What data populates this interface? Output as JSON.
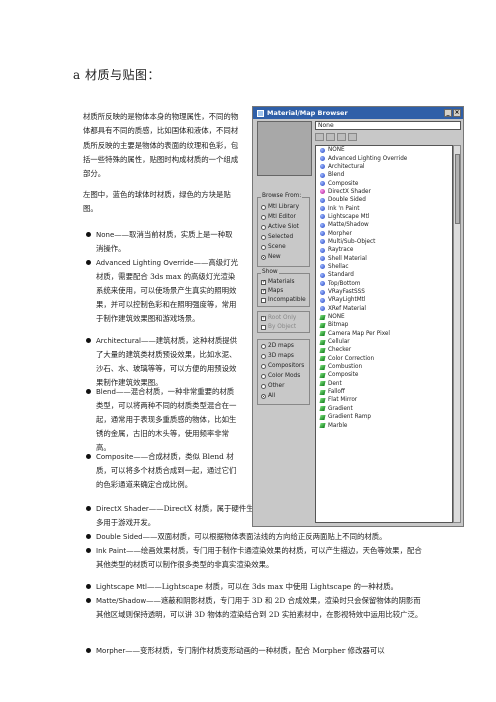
{
  "heading": "a 材质与贴图：",
  "intro": [
    "材质所反映的是物体本身的物理属性，不同的物体都具有不同的质感，比如国体和液体，不同材质所反映的主要是物体的表面的纹理和色彩，包括一些特殊的属性，贴图时构成材质的一个组成部分。",
    "左图中，蓝色的球体时材质，绿色的方块是贴图。"
  ],
  "definitions": [
    {
      "term": "None",
      "text": "——取消当前材质，实质上是一种取消操作。"
    },
    {
      "term": "Advanced Lighting Override",
      "text": "——高级灯光材质，需要配合 3ds max 的高级灯光渲染系统来使用，可以使场景产生真实的照明效果，并可以控制色彩和在照明强度等，常用于制作建筑效果图和游戏场景。"
    },
    {
      "term": "Architectural",
      "text": "——建筑材质，这种材质提供了大量的建筑类材质预设效果，比如水泥、沙石、水、玻璃等等，可以方便的用预设效果制作建筑效果图。"
    },
    {
      "term": "Blend",
      "text": "——混合材质，一种非常重要的材质类型，可以将两种不同的材质类型混合在一起，通常用于表现多重质感的物体，比如生锈的金属，古旧的木头等，使用频率非常高。"
    },
    {
      "term": "Composite",
      "text": "——合成材质，类似 Blend 材质，可以将多个材质合成到一起，通过它们的色彩通道来确定合成比例。"
    },
    {
      "term": "DirectX Shader",
      "text": "——DirectX 材质，属于硬件生成的效果，直接由显示卡运算产生的实时材质效果，多用于游戏开发。"
    },
    {
      "term": "Double Sided",
      "text": "——双面材质，可以根据物体表面法线的方向给正反两面贴上不同的材质。"
    },
    {
      "term": "Ink Paint",
      "text": "——绘画效果材质，专门用于制作卡通渲染效果的材质，可以产生描边，天色等效果，配合其他类型的材质可以制作很多类型的非真实渲染效果。"
    },
    {
      "term": "Lightscape Mtl",
      "text": "——Lightscape 材质，可以在 3ds max 中使用 Lightscape 的一种材质。"
    },
    {
      "term": "Matte/Shadow",
      "text": "——遮蔽和阴影材质，专门用于 3D 和 2D 合成效果，渲染时只会保留物体的阴影而其他区域则保持透明，可以讲 3D 物体的渲染结合到 2D 实拍素材中，在影视特效中运用比较广泛。"
    },
    {
      "term": "Morpher",
      "text": "——变形材质，专门制作材质变形动画的一种材质，配合 Morpher 修改器可以"
    }
  ],
  "browser": {
    "title": "Material/Map Browser",
    "name_value": "None",
    "browse_from_label": "Browse From:",
    "browse_from": [
      {
        "label": "Mtl Library",
        "selected": false
      },
      {
        "label": "Mtl Editor",
        "selected": false
      },
      {
        "label": "Active Slot",
        "selected": false
      },
      {
        "label": "Selected",
        "selected": false
      },
      {
        "label": "Scene",
        "selected": false
      },
      {
        "label": "New",
        "selected": true
      }
    ],
    "show_label": "Show",
    "show": [
      {
        "label": "Materials",
        "checked": true,
        "enabled": true
      },
      {
        "label": "Maps",
        "checked": true,
        "enabled": true
      },
      {
        "label": "Incompatible",
        "checked": false,
        "enabled": true
      },
      {
        "label": "Root Only",
        "checked": true,
        "enabled": false
      },
      {
        "label": "By Object",
        "checked": false,
        "enabled": false
      }
    ],
    "map_types": [
      {
        "label": "2D maps",
        "selected": false
      },
      {
        "label": "3D maps",
        "selected": false
      },
      {
        "label": "Compositors",
        "selected": false
      },
      {
        "label": "Color Mods",
        "selected": false
      },
      {
        "label": "Other",
        "selected": false
      },
      {
        "label": "All",
        "selected": true
      }
    ],
    "materials": [
      "NONE",
      "Advanced Lighting Override",
      "Architectural",
      "Blend",
      "Composite",
      "DirectX Shader",
      "Double Sided",
      "Ink 'n Paint",
      "Lightscape Mtl",
      "Matte/Shadow",
      "Morpher",
      "Multi/Sub-Object",
      "Raytrace",
      "Shell Material",
      "Shellac",
      "Standard",
      "Top/Bottom",
      "VRayFastSSS",
      "VRayLightMtl",
      "XRef Material"
    ],
    "maps": [
      "NONE",
      "Bitmap",
      "Camera Map Per Pixel",
      "Cellular",
      "Checker",
      "Color Correction",
      "Combustion",
      "Composite",
      "Dent",
      "Falloff",
      "Flat Mirror",
      "Gradient",
      "Gradient Ramp",
      "Marble"
    ],
    "colors": {
      "title_bar": "#2f5fa8",
      "material_icon": "#1d3fbf",
      "directx_icon": "#a3148e",
      "map_icon": "#0d7a18"
    }
  }
}
